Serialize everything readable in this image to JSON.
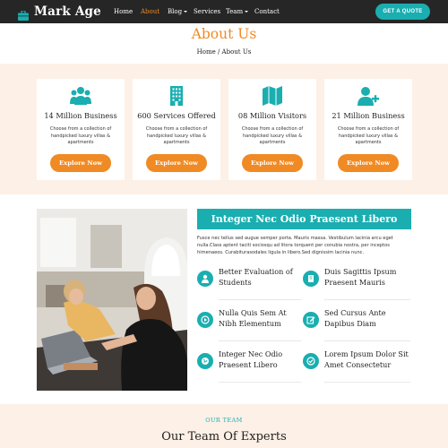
{
  "brand": {
    "name": "Mark Age",
    "icon": "briefcase-icon"
  },
  "nav": {
    "items": [
      {
        "label": "Home",
        "active": false,
        "dropdown": false
      },
      {
        "label": "About",
        "active": true,
        "dropdown": false
      },
      {
        "label": "Blog",
        "active": false,
        "dropdown": true
      },
      {
        "label": "Services",
        "active": false,
        "dropdown": false
      },
      {
        "label": "Team",
        "active": false,
        "dropdown": true
      },
      {
        "label": "Contact",
        "active": false,
        "dropdown": false
      }
    ],
    "cta_label": "GET A QUOTE"
  },
  "header": {
    "title": "About Us",
    "breadcrumb": "Home / About Us"
  },
  "features": [
    {
      "icon": "users-icon",
      "title": "14 Million Business",
      "description": "Choose from a collection of handpicked luxury villas & apartments",
      "button": "Explore Now"
    },
    {
      "icon": "building-icon",
      "title": "600 Services Offered",
      "description": "Choose from a collection of handpicked luxury villas & apartments",
      "button": "Explore Now"
    },
    {
      "icon": "map-icon",
      "title": "08 Million Visitors",
      "description": "Choose from a collection of handpicked luxury villas & apartments",
      "button": "Explore Now"
    },
    {
      "icon": "user-plus-icon",
      "title": "21 Million Business",
      "description": "Choose from a collection of handpicked luxury villas & apartments",
      "button": "Explore Now"
    }
  ],
  "about": {
    "heading": "Integer Nec Odio Praesent Libero",
    "paragraph": "Fusce nec tellus sed augue semper porta. Mauris massa. Vestibulum lacinia arcu eget nulla.Class aptent taciti sociosqu ad litora torquent per conubia nostra, per inceptos himenaeos. Curabiturasodales ligula in libero.Sed dignissim lacinia nunc.",
    "points": [
      {
        "icon": "user-icon",
        "text": "Better Evaluation of Students"
      },
      {
        "icon": "book-icon",
        "text": "Duis Sagittis Ipsum Praesent Mauris"
      },
      {
        "icon": "play-icon",
        "text": "Nulla Quis Sem At Nibh Elementum"
      },
      {
        "icon": "edit-icon",
        "text": "Sed Cursus Ante Dapibus Diam"
      },
      {
        "icon": "globe-icon",
        "text": "Integer Nec Odio Praesent Libero"
      },
      {
        "icon": "check-circle-icon",
        "text": "Lorem Ipsum Dolor Sit Amet Consectetur"
      }
    ]
  },
  "team": {
    "kicker": "OUR TEAM",
    "title": "Our Team Of Experts"
  },
  "colors": {
    "accent_orange": "#f08a24",
    "accent_teal": "#1aaeb0",
    "navbar": "#262626",
    "band_peach": "#fdf0e6"
  }
}
